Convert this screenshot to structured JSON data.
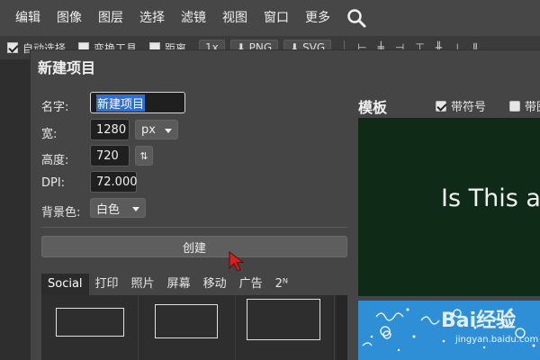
{
  "menu": {
    "items": [
      "编辑",
      "图像",
      "图层",
      "选择",
      "滤镜",
      "视图",
      "窗口",
      "更多"
    ],
    "search_icon": "search-icon"
  },
  "toolbar": {
    "auto_select_label": "自动选择",
    "auto_select_checked": true,
    "transform_label": "变换工具",
    "transform_checked": false,
    "distance_label": "距离",
    "distance_checked": false,
    "scale_value": "1x",
    "png_label": "PNG",
    "svg_label": "SVG"
  },
  "dialog": {
    "title": "新建项目",
    "name_label": "名字:",
    "name_value": "新建项目",
    "width_label": "宽:",
    "width_value": "1280",
    "unit_value": "px",
    "height_label": "高度:",
    "height_value": "720",
    "dpi_label": "DPI:",
    "dpi_value": "72.000",
    "bg_label": "背景色:",
    "bg_value": "白色",
    "create_label": "创建",
    "tabs": [
      "Social",
      "打印",
      "照片",
      "屏幕",
      "移动",
      "广告",
      "2ᴺ"
    ],
    "active_tab": "Social"
  },
  "templates": {
    "title": "模板",
    "symbols_label": "带符号",
    "symbols_checked": true,
    "second_label": "带图",
    "second_checked": false,
    "card1_text": "Is This a",
    "card1_bg": "#0f2b17",
    "card2_bg": "#2f8fd6"
  },
  "watermark": {
    "logo_text": "Bai经验",
    "url": "jingyan.baidu.com"
  },
  "colors": {
    "menubar": "#474747",
    "dialog": "#454545",
    "selection": "#2f6fd1",
    "cursor": "#d42020"
  }
}
